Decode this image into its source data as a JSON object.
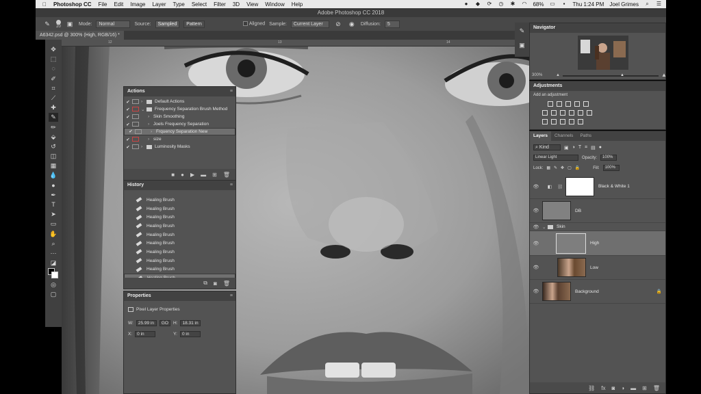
{
  "menubar": {
    "apple": "",
    "app": "Photoshop CC",
    "items": [
      "File",
      "Edit",
      "Image",
      "Layer",
      "Type",
      "Select",
      "Filter",
      "3D",
      "View",
      "Window",
      "Help"
    ],
    "battery": "68%",
    "clock": "Thu 1:24 PM",
    "user": "Joel Grimes"
  },
  "window_title": "Adobe Photoshop CC 2018",
  "options": {
    "mode_label": "Mode:",
    "mode_value": "Normal",
    "source_label": "Source:",
    "sampled": "Sampled",
    "pattern": "Pattern",
    "aligned": "Aligned",
    "sample_label": "Sample:",
    "sample_value": "Current Layer",
    "diffusion_label": "Diffusion:",
    "diffusion_value": "5",
    "brush_size": "20"
  },
  "document_tab": "A6342.psd @ 300% (High, RGB/16) *",
  "ruler_marks": [
    "12",
    "13",
    "14"
  ],
  "actions": {
    "title": "Actions",
    "rows": [
      {
        "check": "✔",
        "label": "Default Actions",
        "indent": 0,
        "folder": true,
        "expanded": false,
        "red": false,
        "selected": false
      },
      {
        "check": "✔",
        "label": "Frequency Separation Brush Method",
        "indent": 0,
        "folder": true,
        "expanded": true,
        "red": true,
        "selected": false
      },
      {
        "check": "✔",
        "label": "Skin Smoothing",
        "indent": 1,
        "folder": false,
        "expanded": false,
        "red": false,
        "selected": false
      },
      {
        "check": "✔",
        "label": "Joels Frequency Separation",
        "indent": 1,
        "folder": false,
        "expanded": false,
        "red": false,
        "selected": false
      },
      {
        "check": "✔",
        "label": "Frquency Separation New",
        "indent": 1,
        "folder": false,
        "expanded": false,
        "red": false,
        "selected": true
      },
      {
        "check": "✔",
        "label": "size",
        "indent": 1,
        "folder": false,
        "expanded": false,
        "red": true,
        "selected": false
      },
      {
        "check": "✔",
        "label": "Luminosity Masks",
        "indent": 0,
        "folder": true,
        "expanded": false,
        "red": false,
        "selected": false
      }
    ]
  },
  "history": {
    "title": "History",
    "items": [
      "Healing Brush",
      "Healing Brush",
      "Healing Brush",
      "Healing Brush",
      "Healing Brush",
      "Healing Brush",
      "Healing Brush",
      "Healing Brush",
      "Healing Brush",
      "Healing Brush"
    ]
  },
  "properties": {
    "title": "Properties",
    "subtitle": "Pixel Layer Properties",
    "w_label": "W:",
    "w_value": "25.99 in",
    "go_label": "GO",
    "h_label": "H:",
    "h_value": "18.31 in",
    "x_label": "X:",
    "x_value": "0 in",
    "y_label": "Y:",
    "y_value": "0 in"
  },
  "navigator": {
    "title": "Navigator",
    "zoom": "300%"
  },
  "adjustments": {
    "title": "Adjustments",
    "subtitle": "Add an adjustment"
  },
  "layers": {
    "tabs": [
      "Layers",
      "Channels",
      "Paths"
    ],
    "filter_kind": "Kind",
    "blend_mode": "Linear Light",
    "opacity_label": "Opacity:",
    "opacity": "100%",
    "lock_label": "Lock:",
    "fill_label": "Fill:",
    "fill": "100%",
    "rows": [
      {
        "name": "Black & White 1",
        "type": "adjustment"
      },
      {
        "name": "DB",
        "type": "gray"
      },
      {
        "name": "Skin",
        "type": "group"
      },
      {
        "name": "High",
        "type": "gray-selected"
      },
      {
        "name": "Low",
        "type": "photo"
      },
      {
        "name": "Background",
        "type": "photo"
      }
    ]
  },
  "colors": {
    "panel_bg": "#535353",
    "panel_header": "#424242",
    "selected_row": "#6f6f6f",
    "menubar_bg": "#e9e9e9"
  }
}
